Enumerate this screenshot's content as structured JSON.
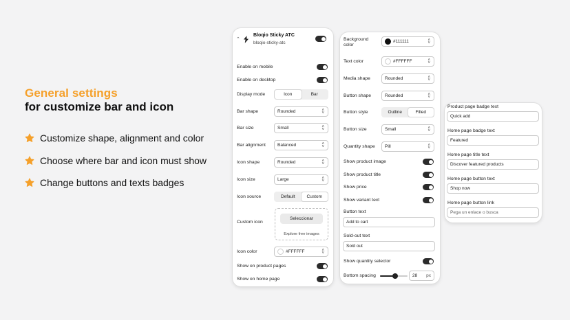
{
  "hero": {
    "title_accent": "General settings",
    "title_main": "for customize bar and icon",
    "features": [
      "Customize shape, alignment and color",
      "Choose where bar and icon must show",
      "Change buttons and texts badges"
    ],
    "accent_color": "#F5A02A"
  },
  "panel1": {
    "app_name": "Bloqio Sticky ATC",
    "app_handle": "bloqio-sticky-atc",
    "enable_mobile": "Enable on mobile",
    "enable_desktop": "Enable on desktop",
    "display_mode": "Display mode",
    "display_mode_opts": [
      "Icon",
      "Bar"
    ],
    "bar_shape": "Bar shape",
    "bar_shape_val": "Rounded",
    "bar_size": "Bar size",
    "bar_size_val": "Small",
    "bar_alignment": "Bar alignment",
    "bar_alignment_val": "Balanced",
    "icon_shape": "Icon shape",
    "icon_shape_val": "Rounded",
    "icon_size": "Icon size",
    "icon_size_val": "Large",
    "icon_source": "Icon source",
    "icon_source_opts": [
      "Default",
      "Custom"
    ],
    "custom_icon": "Custom icon",
    "select_btn": "Seleccionar",
    "explore": "Explore free images",
    "icon_color": "Icon color",
    "icon_color_val": "#FFFFFF",
    "show_product": "Show on product pages",
    "show_home": "Show on home page"
  },
  "panel2": {
    "bg_color": "Background color",
    "bg_color_val": "#111111",
    "text_color": "Text color",
    "text_color_val": "#FFFFFF",
    "media_shape": "Media shape",
    "media_shape_val": "Rounded",
    "button_shape": "Button shape",
    "button_shape_val": "Rounded",
    "button_style": "Button style",
    "button_style_opts": [
      "Outline",
      "Filled"
    ],
    "button_size": "Button size",
    "button_size_val": "Small",
    "quantity_shape": "Quantity shape",
    "quantity_shape_val": "Pill",
    "show_image": "Show product image",
    "show_title": "Show product title",
    "show_price": "Show price",
    "show_variant": "Show variant text",
    "button_text": "Button text",
    "button_text_val": "Add to cart",
    "soldout_text": "Sold-out text",
    "soldout_text_val": "Sold out",
    "show_qty": "Show quantity selector",
    "bottom_spacing": "Bottom spacing",
    "bottom_spacing_val": "28",
    "bottom_spacing_unit": "px",
    "bottom_spacing_fraction": 0.55
  },
  "panel3": {
    "badge_label": "Product page badge text",
    "badge_val": "Quick add",
    "home_badge_label": "Home page badge text",
    "home_badge_val": "Featured",
    "home_title_label": "Home page title text",
    "home_title_val": "Discover featured products",
    "home_btn_label": "Home page button text",
    "home_btn_val": "Shop now",
    "home_link_label": "Home page button link",
    "home_link_placeholder": "Pega un enlace o busca"
  }
}
